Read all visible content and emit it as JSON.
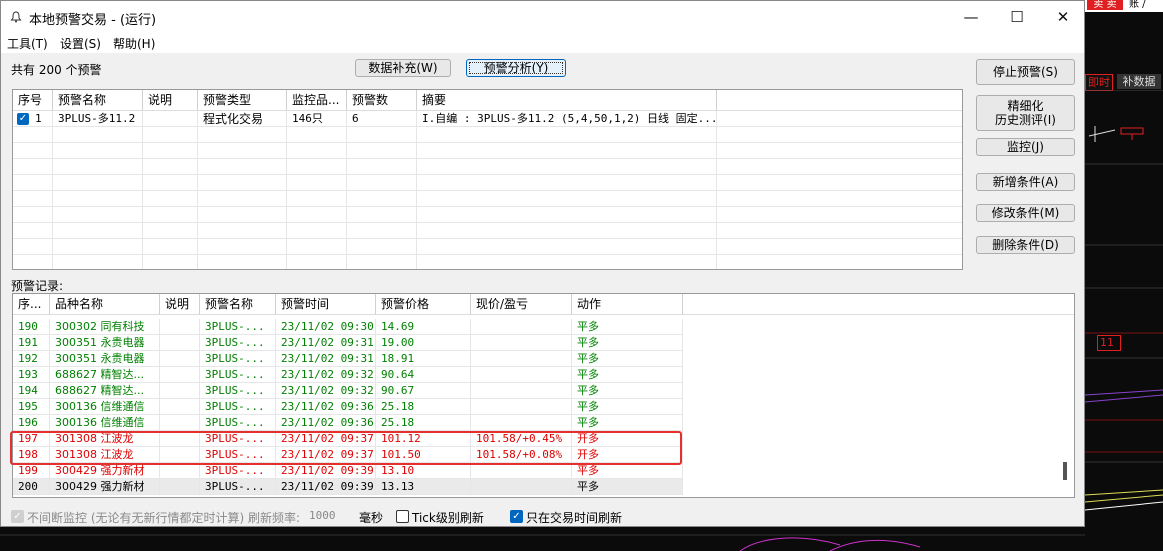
{
  "background": {
    "sell_button": "卖 卖",
    "top_right_text": "账 /",
    "tab_live": "即时",
    "tab_fill": "补数据",
    "label_11": "11"
  },
  "window": {
    "title": "本地预警交易 - (运行)",
    "app_icon": "bell-icon",
    "minimize": "—",
    "maximize": "☐",
    "close": "✕"
  },
  "menu": {
    "tools": "工具(T)",
    "settings": "设置(S)",
    "help": "帮助(H)"
  },
  "summary": {
    "count_text": "共有 200 个预警"
  },
  "toolbar": {
    "data_fill": "数据补充(W)",
    "analysis": "预警分析(Y)"
  },
  "side_buttons": {
    "stop": "停止预警(S)",
    "refine_line1": "精细化",
    "refine_line2": "历史测评(I)",
    "monitor": "监控(J)",
    "add": "新增条件(A)",
    "modify": "修改条件(M)",
    "delete": "删除条件(D)"
  },
  "alerts_table": {
    "columns": [
      "序号",
      "预警名称",
      "说明",
      "预警类型",
      "监控品...",
      "预警数",
      "摘要"
    ],
    "rows": [
      {
        "checked": true,
        "no": "1",
        "name": "3PLUS-多11.2",
        "desc": "",
        "type": "程式化交易",
        "monitor": "146只",
        "count": "6",
        "summary": "I.自编 : 3PLUS-多11.2 (5,4,50,1,2) 日线 固定..."
      }
    ]
  },
  "records_label": "预警记录:",
  "records_table": {
    "columns": [
      "序...",
      "品种名称",
      "说明",
      "预警名称",
      "预警时间",
      "预警价格",
      "现价/盈亏",
      "动作"
    ],
    "rows": [
      {
        "no": "190",
        "stock": "300302 同有科技",
        "desc": "",
        "alert": "3PLUS-...",
        "time": "23/11/02 09:30",
        "price": "14.69",
        "pnl": "",
        "action": "平多",
        "color": "green"
      },
      {
        "no": "191",
        "stock": "300351 永贵电器",
        "desc": "",
        "alert": "3PLUS-...",
        "time": "23/11/02 09:31",
        "price": "19.00",
        "pnl": "",
        "action": "平多",
        "color": "green"
      },
      {
        "no": "192",
        "stock": "300351 永贵电器",
        "desc": "",
        "alert": "3PLUS-...",
        "time": "23/11/02 09:31",
        "price": "18.91",
        "pnl": "",
        "action": "平多",
        "color": "green"
      },
      {
        "no": "193",
        "stock": "688627 精智达...",
        "desc": "",
        "alert": "3PLUS-...",
        "time": "23/11/02 09:32",
        "price": "90.64",
        "pnl": "",
        "action": "平多",
        "color": "green"
      },
      {
        "no": "194",
        "stock": "688627 精智达...",
        "desc": "",
        "alert": "3PLUS-...",
        "time": "23/11/02 09:32",
        "price": "90.67",
        "pnl": "",
        "action": "平多",
        "color": "green"
      },
      {
        "no": "195",
        "stock": "300136 信维通信",
        "desc": "",
        "alert": "3PLUS-...",
        "time": "23/11/02 09:36",
        "price": "25.18",
        "pnl": "",
        "action": "平多",
        "color": "green"
      },
      {
        "no": "196",
        "stock": "300136 信维通信",
        "desc": "",
        "alert": "3PLUS-...",
        "time": "23/11/02 09:36",
        "price": "25.18",
        "pnl": "",
        "action": "平多",
        "color": "green"
      },
      {
        "no": "197",
        "stock": "301308 江波龙",
        "desc": "",
        "alert": "3PLUS-...",
        "time": "23/11/02 09:37",
        "price": "101.12",
        "pnl": "101.58/+0.45%",
        "action": "开多",
        "color": "red"
      },
      {
        "no": "198",
        "stock": "301308 江波龙",
        "desc": "",
        "alert": "3PLUS-...",
        "time": "23/11/02 09:37",
        "price": "101.50",
        "pnl": "101.58/+0.08%",
        "action": "开多",
        "color": "red"
      },
      {
        "no": "199",
        "stock": "300429 强力新材",
        "desc": "",
        "alert": "3PLUS-...",
        "time": "23/11/02 09:39",
        "price": "13.10",
        "pnl": "",
        "action": "平多",
        "color": "red"
      },
      {
        "no": "200",
        "stock": "300429 强力新材",
        "desc": "",
        "alert": "3PLUS-...",
        "time": "23/11/02 09:39",
        "price": "13.13",
        "pnl": "",
        "action": "平多",
        "color": "black"
      }
    ]
  },
  "footer": {
    "continuous_label": "不间断监控 (无论有无新行情都定时计算) 刷新频率:",
    "rate_value": "1000",
    "ms_label": "毫秒",
    "tick_label": "Tick级别刷新",
    "trade_time_label": "只在交易时间刷新",
    "continuous_checked": true,
    "tick_checked": false,
    "trade_time_checked": true
  }
}
